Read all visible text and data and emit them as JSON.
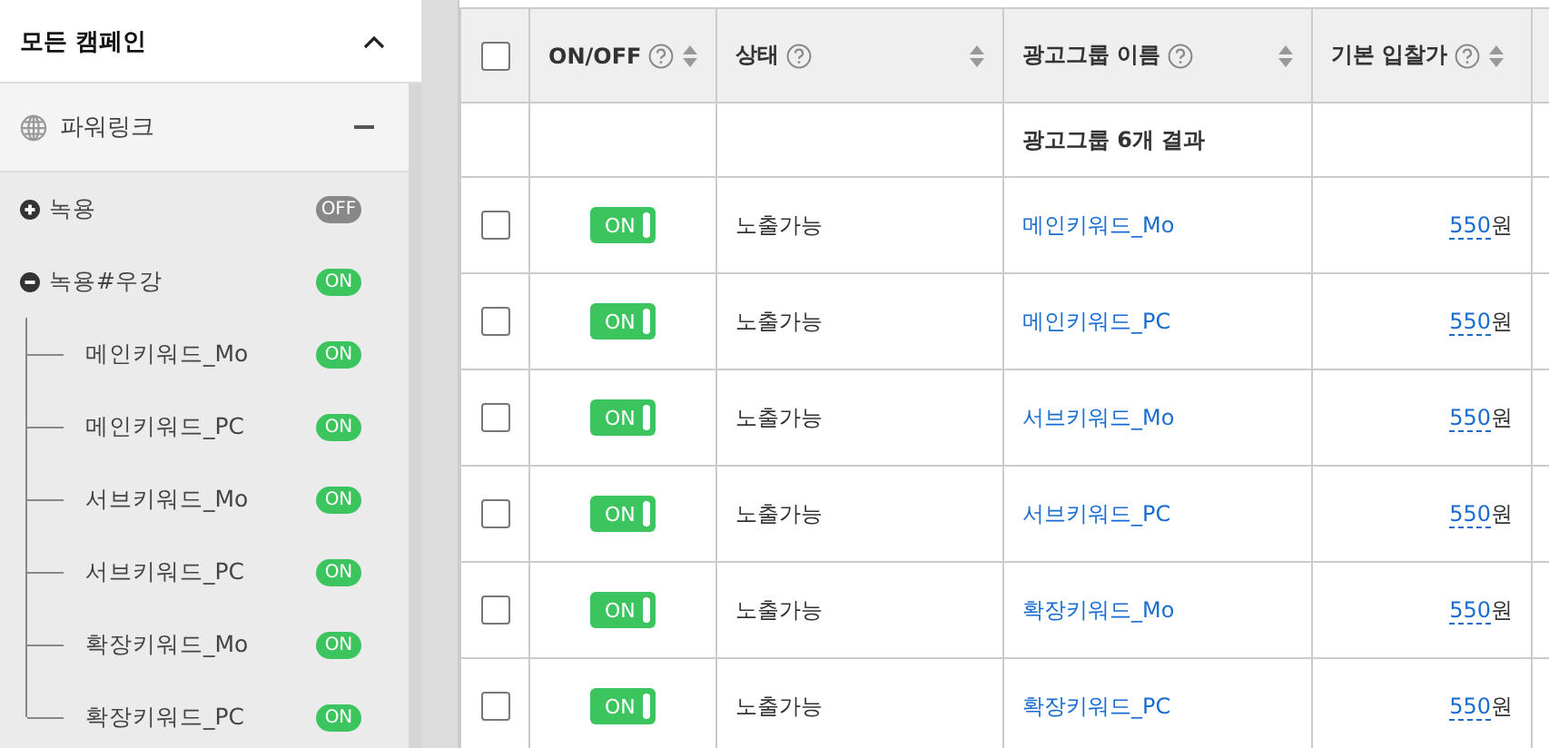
{
  "sidebar": {
    "title": "모든 캠페인",
    "expanded": true,
    "group": {
      "label": "파워링크",
      "expanded": true
    },
    "campaigns": [
      {
        "name": "녹용",
        "expanded": false,
        "on": false,
        "toggle_text": "OFF"
      },
      {
        "name": "녹용#우강",
        "expanded": true,
        "on": true,
        "toggle_text": "ON",
        "children": [
          {
            "name": "메인키워드_Mo",
            "on": true,
            "toggle_text": "ON"
          },
          {
            "name": "메인키워드_PC",
            "on": true,
            "toggle_text": "ON"
          },
          {
            "name": "서브키워드_Mo",
            "on": true,
            "toggle_text": "ON"
          },
          {
            "name": "서브키워드_PC",
            "on": true,
            "toggle_text": "ON"
          },
          {
            "name": "확장키워드_Mo",
            "on": true,
            "toggle_text": "ON"
          },
          {
            "name": "확장키워드_PC",
            "on": true,
            "toggle_text": "ON"
          }
        ]
      }
    ]
  },
  "table": {
    "columns": [
      {
        "kind": "checkbox",
        "checked": false
      },
      {
        "kind": "onoff",
        "label": "ON/OFF"
      },
      {
        "kind": "status",
        "label": "상태"
      },
      {
        "kind": "name",
        "label": "광고그룹 이름"
      },
      {
        "kind": "bid",
        "label": "기본 입찰가"
      }
    ],
    "summary": "광고그룹 6개 결과",
    "rows": [
      {
        "checked": false,
        "on": true,
        "toggle_text": "ON",
        "status": "노출가능",
        "name": "메인키워드_Mo",
        "bid": "550",
        "unit": "원"
      },
      {
        "checked": false,
        "on": true,
        "toggle_text": "ON",
        "status": "노출가능",
        "name": "메인키워드_PC",
        "bid": "550",
        "unit": "원"
      },
      {
        "checked": false,
        "on": true,
        "toggle_text": "ON",
        "status": "노출가능",
        "name": "서브키워드_Mo",
        "bid": "550",
        "unit": "원"
      },
      {
        "checked": false,
        "on": true,
        "toggle_text": "ON",
        "status": "노출가능",
        "name": "서브키워드_PC",
        "bid": "550",
        "unit": "원"
      },
      {
        "checked": false,
        "on": true,
        "toggle_text": "ON",
        "status": "노출가능",
        "name": "확장키워드_Mo",
        "bid": "550",
        "unit": "원"
      },
      {
        "checked": false,
        "on": true,
        "toggle_text": "ON",
        "status": "노출가능",
        "name": "확장키워드_PC",
        "bid": "550",
        "unit": "원"
      }
    ]
  }
}
